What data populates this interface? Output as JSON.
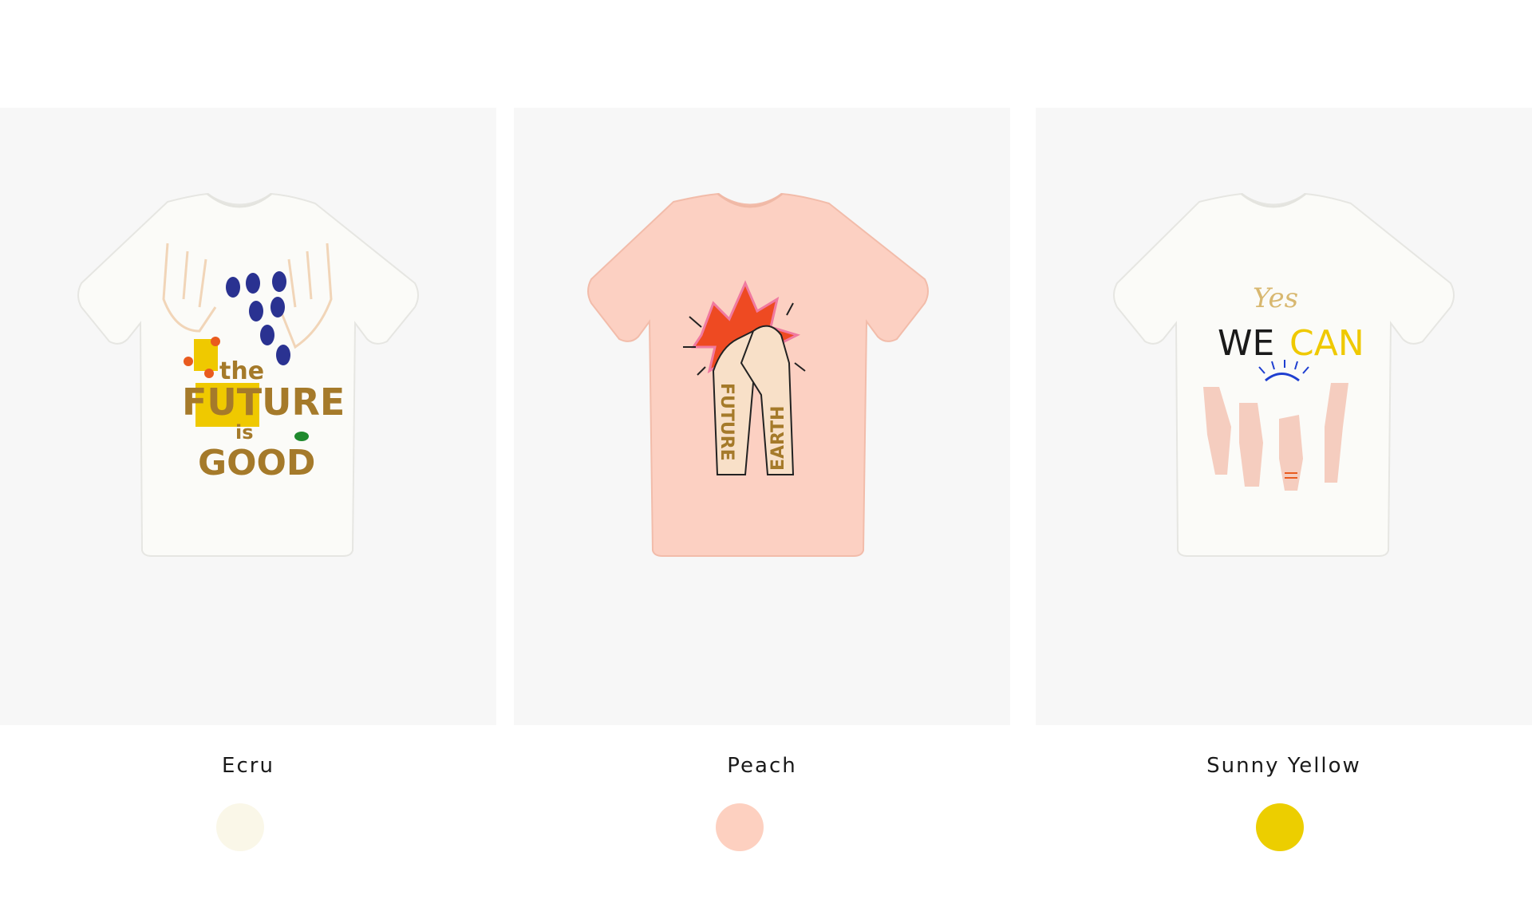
{
  "products": [
    {
      "color_name": "Ecru",
      "swatch_color": "#faf7e8",
      "shirt_color": "#fbfbf8",
      "print_text": [
        "the",
        "FUTURE",
        "is",
        "GOOD"
      ],
      "print_text_color": "#a57a2a"
    },
    {
      "color_name": "Peach",
      "swatch_color": "#fdd0c0",
      "shirt_color": "#fcd0c2",
      "print_text": [
        "FUTURE",
        "EARTH"
      ],
      "print_text_color": "#a57a2a"
    },
    {
      "color_name": "Sunny Yellow",
      "swatch_color": "#ecce00",
      "shirt_color": "#fbfbf8",
      "print_text": [
        "Yes",
        "WE",
        "CAN"
      ],
      "print_text_color": "#1a1a1a"
    }
  ]
}
